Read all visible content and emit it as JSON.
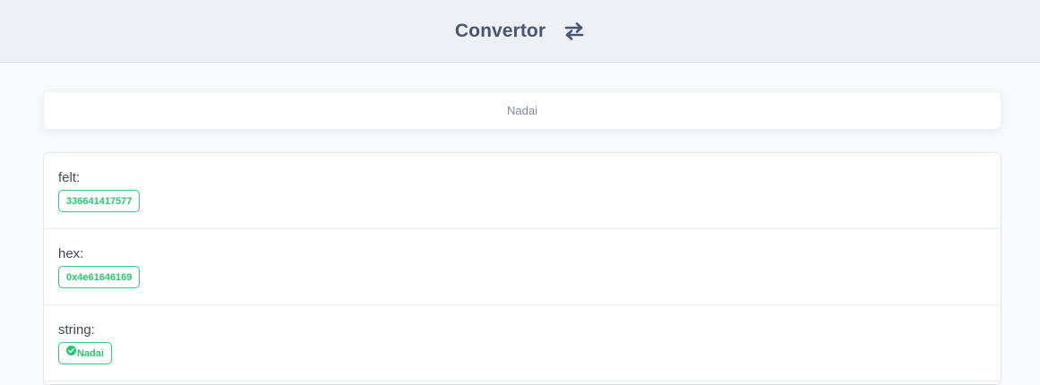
{
  "header": {
    "title": "Convertor",
    "icon": "swap-arrows-icon"
  },
  "input": {
    "value": "Nadai"
  },
  "results": [
    {
      "label": "felt:",
      "value": "336641417577"
    },
    {
      "label": "hex:",
      "value": "0x4e61646169"
    },
    {
      "label": "string:",
      "value": "Nadai",
      "icon": "check-circle-icon"
    }
  ],
  "colors": {
    "accent_green": "#28c76f",
    "header_bg": "#edf1f5",
    "title_text": "#4a5570"
  }
}
